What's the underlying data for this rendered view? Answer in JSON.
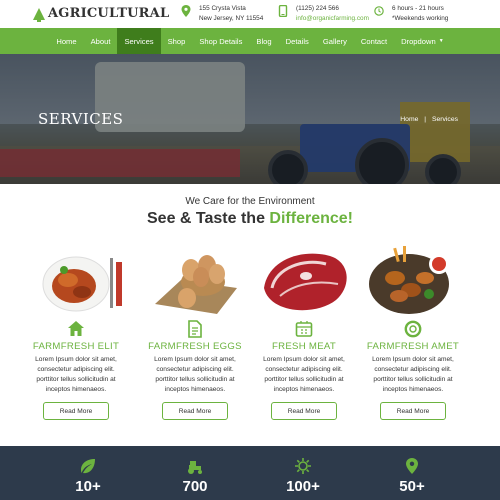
{
  "header": {
    "brand": "AGRICULTURAL",
    "address": {
      "line1": "155 Crysta Vista",
      "line2": "New Jersey, NY 11554"
    },
    "contact": {
      "phone": "(1125) 224 566",
      "email": "info@organicfarming.com"
    },
    "hours": {
      "line1": "6 hours - 21 hours",
      "line2": "*Weekends working"
    }
  },
  "nav": {
    "items": [
      "Home",
      "About",
      "Services",
      "Shop",
      "Shop Details",
      "Blog",
      "Details",
      "Gallery",
      "Contact",
      "Dropdown"
    ],
    "active": "Services"
  },
  "hero": {
    "title": "SERVICES",
    "breadcrumb": {
      "home": "Home",
      "separator": "|",
      "current": "Services"
    }
  },
  "intro": {
    "subtitle": "We Care for the Environment",
    "title_prefix": "See & Taste the ",
    "title_highlight": "Difference!"
  },
  "cards": [
    {
      "icon": "home-icon",
      "name": "FARMFRESH ELIT",
      "desc": [
        "Lorem Ipsum dolor sit amet,",
        "consectetur adipiscing elit.",
        "porttitor tellus sollicitudin at",
        "inceptos himenaeos."
      ],
      "button": "Read More"
    },
    {
      "icon": "document-icon",
      "name": "FARMFRESH EGGS",
      "desc": [
        "Lorem Ipsum dolor sit amet,",
        "consectetur adipiscing elit.",
        "porttitor tellus sollicitudin at",
        "inceptos himenaeos."
      ],
      "button": "Read More"
    },
    {
      "icon": "calendar-icon",
      "name": "FRESH MEAT",
      "desc": [
        "Lorem Ipsum dolor sit amet,",
        "consectetur adipiscing elit.",
        "porttitor tellus sollicitudin at",
        "inceptos himenaeos."
      ],
      "button": "Read More"
    },
    {
      "icon": "lifebuoy-icon",
      "name": "FARMFRESH AMET",
      "desc": [
        "Lorem Ipsum dolor sit amet,",
        "consectetur adipiscing elit.",
        "porttitor tellus sollicitudin at",
        "inceptos himenaeos."
      ],
      "button": "Read More"
    }
  ],
  "stats": [
    {
      "icon": "leaf-icon",
      "value": "10+"
    },
    {
      "icon": "tractor-icon",
      "value": "700"
    },
    {
      "icon": "sun-icon",
      "value": "100+"
    },
    {
      "icon": "map-pin-icon",
      "value": "50+"
    }
  ],
  "colors": {
    "accent": "#6cb33f",
    "accent_dark": "#3f7d1c",
    "stats_bg": "#2d3a4b"
  }
}
